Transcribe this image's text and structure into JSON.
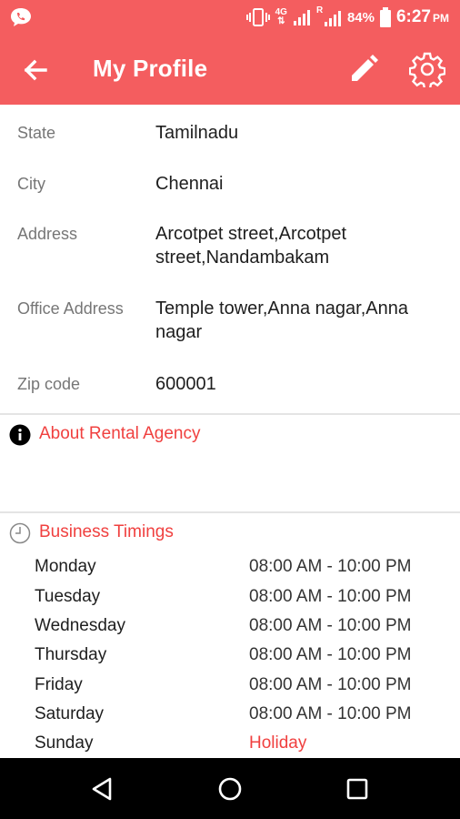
{
  "status_bar": {
    "network": "4G",
    "roaming": "R",
    "battery": "84%",
    "time": "6:27",
    "ampm": "PM"
  },
  "toolbar": {
    "title": "My Profile"
  },
  "profile": {
    "rows": [
      {
        "label": "State",
        "value": "Tamilnadu"
      },
      {
        "label": "City",
        "value": "Chennai"
      },
      {
        "label": "Address",
        "value": "Arcotpet street,Arcotpet street,Nandambakam"
      },
      {
        "label": "Office Address",
        "value": "Temple tower,Anna nagar,Anna nagar"
      },
      {
        "label": "Zip code",
        "value": "600001"
      }
    ]
  },
  "about": {
    "heading": "About Rental Agency"
  },
  "business_timings": {
    "heading": "Business Timings",
    "days": [
      {
        "day": "Monday",
        "hours": "08:00 AM - 10:00 PM"
      },
      {
        "day": "Tuesday",
        "hours": "08:00 AM - 10:00 PM"
      },
      {
        "day": "Wednesday",
        "hours": "08:00 AM - 10:00 PM"
      },
      {
        "day": "Thursday",
        "hours": "08:00 AM - 10:00 PM"
      },
      {
        "day": "Friday",
        "hours": "08:00 AM - 10:00 PM"
      },
      {
        "day": "Saturday",
        "hours": "08:00 AM - 10:00 PM"
      },
      {
        "day": "Sunday",
        "hours": "Holiday"
      }
    ]
  },
  "colors": {
    "primary": "#f45d5f",
    "accent_text": "#f0403f",
    "label_gray": "#767676"
  }
}
